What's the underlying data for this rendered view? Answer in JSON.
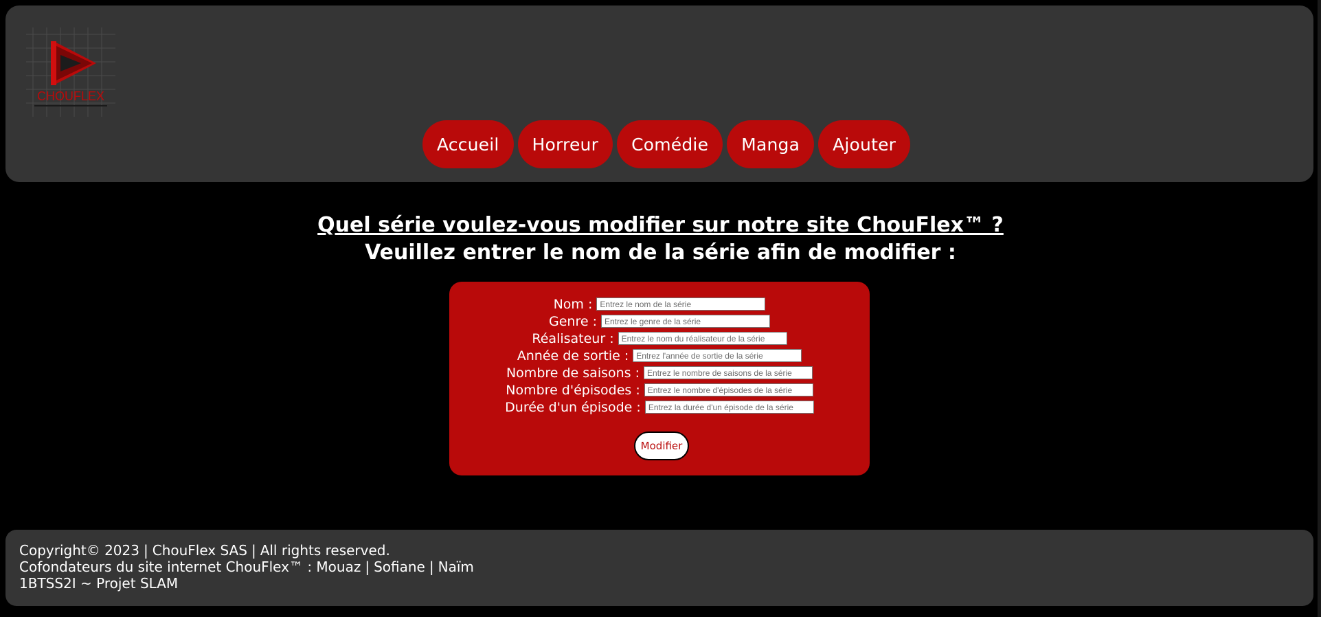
{
  "colors": {
    "background": "#000000",
    "panel": "#353535",
    "accent": "#b90a0a",
    "text": "#ffffff"
  },
  "logo": {
    "text": "CHOUFLEX",
    "icon": "play-triangle-logo-icon"
  },
  "nav": {
    "items": [
      {
        "label": "Accueil"
      },
      {
        "label": "Horreur"
      },
      {
        "label": "Comédie"
      },
      {
        "label": "Manga"
      },
      {
        "label": "Ajouter"
      }
    ]
  },
  "heading": {
    "line1": "Quel série voulez-vous modifier sur notre site ChouFlex™ ?",
    "line2": "Veuillez entrer le nom de la série afin de modifier :"
  },
  "form": {
    "fields": [
      {
        "label": "Nom :",
        "placeholder": "Entrez le nom de la série",
        "value": ""
      },
      {
        "label": "Genre :",
        "placeholder": "Entrez le genre de la série",
        "value": ""
      },
      {
        "label": "Réalisateur :",
        "placeholder": "Entrez le nom du réalisateur de la série",
        "value": ""
      },
      {
        "label": "Année de sortie :",
        "placeholder": "Entrez l'année de sortie de la série",
        "value": ""
      },
      {
        "label": "Nombre de saisons :",
        "placeholder": "Entrez le nombre de saisons de la série",
        "value": ""
      },
      {
        "label": "Nombre d'épisodes :",
        "placeholder": "Entrez le nombre d'épisodes de la série",
        "value": ""
      },
      {
        "label": "Durée d'un épisode :",
        "placeholder": "Entrez la durée d'un épisode de la série",
        "value": ""
      }
    ],
    "submit_label": "Modifier"
  },
  "footer": {
    "line1": {
      "copyright": "Copyright© 2023",
      "company": "ChouFlex SAS",
      "rights": "All rights reserved."
    },
    "line2": {
      "prefix": "Cofondateurs du site internet ChouFlex™ : Mouaz",
      "founder2": "Sofiane",
      "founder3": "Naïm"
    },
    "line3": "1BTSS2I ~ Projet SLAM"
  }
}
